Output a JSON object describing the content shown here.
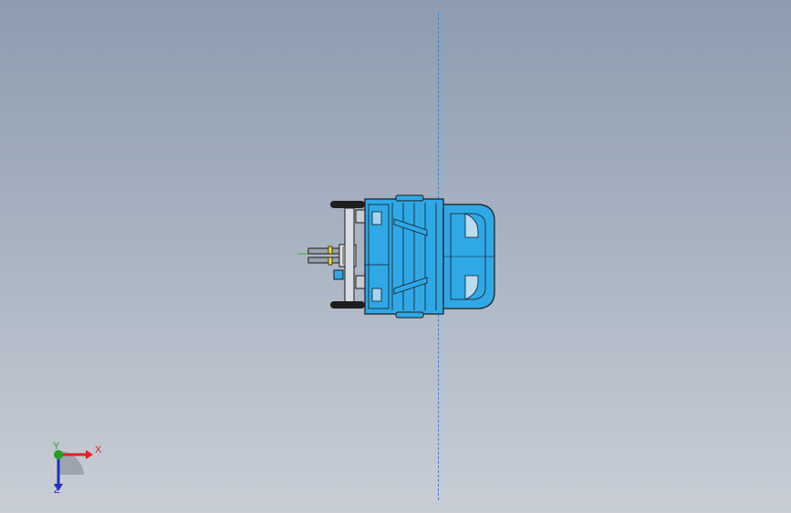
{
  "viewport": {
    "background_top": "#8d9cb0",
    "background_bottom": "#c9ced6",
    "centerline_color": "#2f7fd8"
  },
  "model": {
    "body_color": "#2fa8e6",
    "outline_color": "#1a1a1a",
    "wheel_color": "#1e1e1e",
    "accent_color": "#f2e600"
  },
  "triad": {
    "x_label": "X",
    "y_label": "Y",
    "z_label": "Z",
    "x_color": "#e02020",
    "y_color": "#20a020",
    "z_color": "#2030c0"
  }
}
